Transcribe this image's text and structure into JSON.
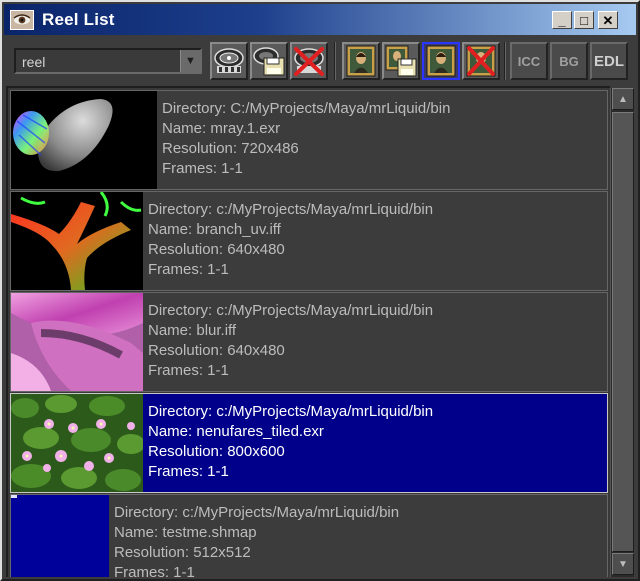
{
  "window": {
    "title": "Reel List",
    "controls": {
      "minimize": "_",
      "maximize": "□",
      "close": "✕"
    }
  },
  "toolbar": {
    "reel_select": {
      "value": "reel"
    },
    "icon_buttons": [
      {
        "icon": "reel-icon"
      },
      {
        "icon": "save-reel-icon"
      },
      {
        "icon": "delete-reel-icon"
      },
      {
        "icon": "image-icon"
      },
      {
        "icon": "save-image-icon"
      },
      {
        "icon": "image-selected-icon"
      },
      {
        "icon": "delete-image-icon"
      }
    ],
    "text_buttons": {
      "icc": "ICC",
      "bg": "BG",
      "edl": "EDL"
    }
  },
  "reel_items": [
    {
      "thumbnail": "egg-render-thumbnail",
      "directory": "Directory: C:/MyProjects/Maya/mrLiquid/bin",
      "name": "Name: mray.1.exr",
      "resolution": "Resolution: 720x486",
      "frames": "Frames: 1-1"
    },
    {
      "thumbnail": "branch-uv-thumbnail",
      "directory": "Directory: c:/MyProjects/Maya/mrLiquid/bin",
      "name": "Name: branch_uv.iff",
      "resolution": "Resolution: 640x480",
      "frames": "Frames: 1-1"
    },
    {
      "thumbnail": "blur-thumbnail",
      "directory": "Directory: c:/MyProjects/Maya/mrLiquid/bin",
      "name": "Name: blur.iff",
      "resolution": "Resolution: 640x480",
      "frames": "Frames: 1-1"
    },
    {
      "thumbnail": "nenufares-thumbnail",
      "directory": "Directory: c:/MyProjects/Maya/mrLiquid/bin",
      "name": "Name: nenufares_tiled.exr",
      "resolution": "Resolution: 800x600",
      "frames": "Frames: 1-1",
      "selected": true
    },
    {
      "thumbnail": "shadow-map-thumbnail",
      "directory": "Directory: c:/MyProjects/Maya/mrLiquid/bin",
      "name": "Name: testme.shmap",
      "resolution": "Resolution: 512x512",
      "frames": "Frames: 1-1"
    }
  ],
  "scrollbar": {
    "up": "▲",
    "down": "▼"
  }
}
